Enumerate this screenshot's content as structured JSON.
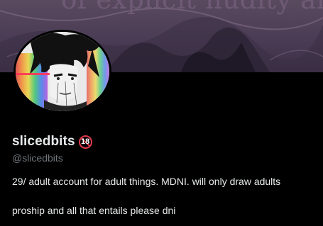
{
  "banner": {
    "text": "of explicit nudity and g"
  },
  "profile": {
    "display_name": "slicedbits",
    "age_badge": "18",
    "handle": "@slicedbits",
    "bio": [
      "29/ adult account for adult things. MDNI. will only draw adults",
      "proship and all that entails please dni"
    ]
  },
  "colors": {
    "background": "#000000",
    "text_primary": "#e7e9ea",
    "text_secondary": "#71767b",
    "badge_red": "#e1394b"
  },
  "icons": {
    "age_badge": "no-under-18-icon"
  }
}
